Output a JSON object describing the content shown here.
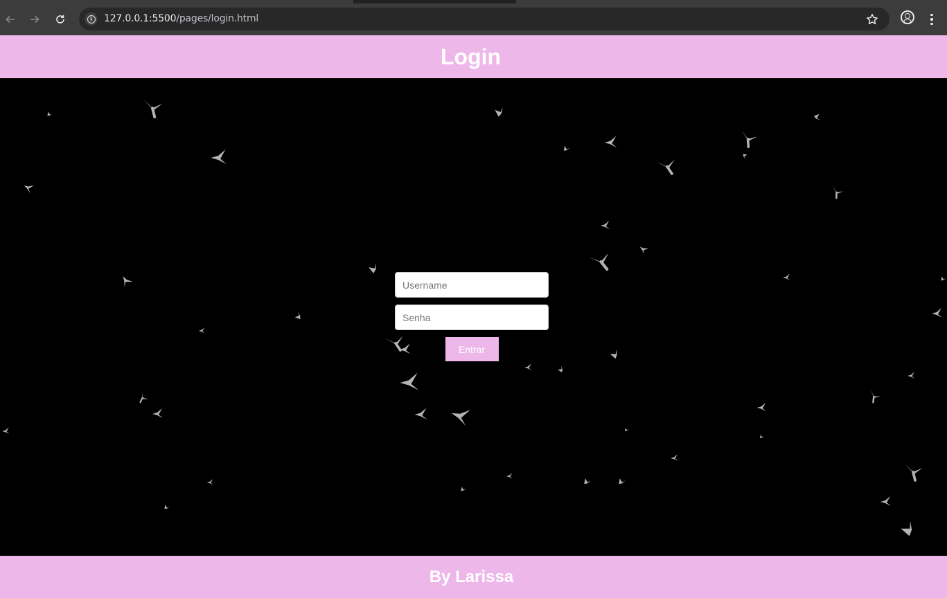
{
  "browser": {
    "url_host": "127.0.0.1:5500",
    "url_path": "/pages/login.html",
    "icons": {
      "back": "arrow-left-icon",
      "forward": "arrow-right-icon",
      "reload": "reload-icon",
      "site_info": "info-icon",
      "bookmark": "star-icon",
      "profile": "profile-icon",
      "menu": "kebab-menu-icon"
    }
  },
  "header": {
    "title": "Login"
  },
  "form": {
    "username_placeholder": "Username",
    "username_value": "",
    "password_placeholder": "Senha",
    "password_value": "",
    "submit_label": "Entrar"
  },
  "footer": {
    "text": "By Larissa"
  },
  "colors": {
    "accent_pink": "#eeb7ea",
    "background": "#000000",
    "bird": "#bdbdbd"
  }
}
